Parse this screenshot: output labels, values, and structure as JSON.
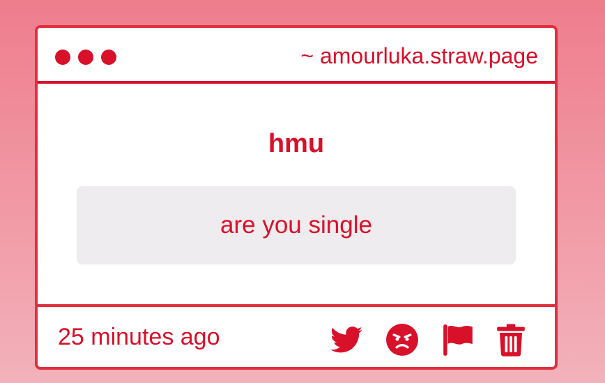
{
  "window": {
    "url": "~ amourluka.straw.page",
    "controls": [
      "dot",
      "dot",
      "dot"
    ]
  },
  "card": {
    "prompt": "hmu",
    "message": "are you single"
  },
  "footer": {
    "timestamp": "25 minutes ago",
    "actions": [
      {
        "name": "share-twitter",
        "icon": "twitter-icon"
      },
      {
        "name": "react-angry",
        "icon": "angry-face-icon"
      },
      {
        "name": "report",
        "icon": "flag-icon"
      },
      {
        "name": "delete",
        "icon": "trash-icon"
      }
    ]
  },
  "colors": {
    "accent": "#d8102a",
    "border": "#e0303f",
    "message_bg": "#eeecee",
    "background_top": "#ef7d8c",
    "background_bottom": "#f3b2bb"
  }
}
